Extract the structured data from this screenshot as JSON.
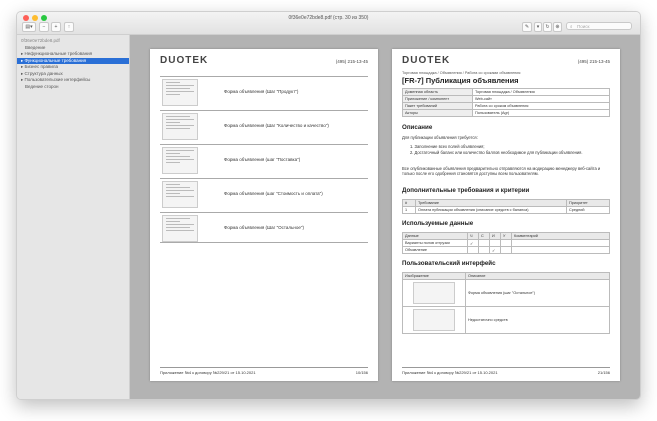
{
  "window": {
    "title": "0f36e0e72bde8.pdf (стр. 30 из 350)",
    "search_placeholder": "Поиск",
    "toolbar": {
      "sidebar": "▤▾",
      "zoom_out": "−",
      "zoom_in": "+",
      "share": "↑",
      "markup": "✎",
      "more": "▾",
      "rotate": "↻",
      "annot": "⊕"
    }
  },
  "sidebar": {
    "items": [
      {
        "label": "0f36e0e72bde8.pdf",
        "type": "head"
      },
      {
        "label": "Введение",
        "type": "ind"
      },
      {
        "label": "▸ Нефункциональные требования",
        "type": "normal"
      },
      {
        "label": "▸ Функциональные требования",
        "type": "sel"
      },
      {
        "label": "▸ Бизнес правила",
        "type": "normal"
      },
      {
        "label": "▸ Структура данных",
        "type": "normal"
      },
      {
        "label": "▸ Пользовательские интерфейсы",
        "type": "normal"
      },
      {
        "label": "Ведение сторон",
        "type": "ind"
      }
    ]
  },
  "left_page": {
    "logo": "DUOTEK",
    "phone": "(495) 215-13-45",
    "rows": [
      {
        "label": "Форма объявления (Шаг \"Продукт\")"
      },
      {
        "label": "Форма объявления (Шаг \"Количество и качество\")"
      },
      {
        "label": "Форма объявления (шаг \"Поставка\")"
      },
      {
        "label": "Форма объявления (шаг \"Стоимость и оплата\")"
      },
      {
        "label": "Форма объявления (Шаг \"Остальное\")"
      }
    ],
    "footer": "Приложение №4 к договору №229/21 от 15.10.2021",
    "page_num": "10/156"
  },
  "right_page": {
    "logo": "DUOTEK",
    "phone": "(495) 215-13-45",
    "breadcrumb": "Торговая площадка / Объявления / Работа со сроками объявления",
    "title": "[FR-7] Публикация объявления",
    "meta": [
      {
        "k": "Доменная область",
        "v": "Торговая площадка / Объявления"
      },
      {
        "k": "Приложение / компонент",
        "v": "Web-сайт"
      },
      {
        "k": "Пакет требований",
        "v": "Работа со сроком объявления"
      },
      {
        "k": "Акторы",
        "v": "Пользователь (Agr)"
      }
    ],
    "desc_h": "Описание",
    "desc_intro": "Для публикации объявления требуется:",
    "desc_items": [
      "1.  Заполнение всех полей объявления;",
      "2.  Достаточный баланс или количество баллов необходимое для публикации объявления."
    ],
    "desc_text": "Все опубликованные объявления предварительно отправляются на модерацию менеджеру веб-сайта и только после его одобрения становятся доступны всем пользователям.",
    "add_h": "Дополнительные требования и критерии",
    "add_head": [
      "#",
      "Требование",
      "Приоритет"
    ],
    "add_rows": [
      [
        "1",
        "Оплата публикации объявления (списание средств с баланса)",
        "Средний"
      ]
    ],
    "data_h": "Используемые данные",
    "data_head": [
      "Данные",
      "Ч",
      "С",
      "И",
      "У",
      "Комментарий"
    ],
    "data_rows": [
      [
        "Варианты полов отгрузки",
        "✓",
        "",
        "",
        "",
        ""
      ],
      [
        "Объявление",
        "",
        "",
        "✓",
        "",
        ""
      ]
    ],
    "ui_h": "Пользовательский интерфейс",
    "ui_head": [
      "Изображение",
      "Описание"
    ],
    "ui_rows": [
      {
        "desc": "Форма объявления (шаг \"Остальное\")"
      },
      {
        "desc": "Недостаточно средств"
      }
    ],
    "footer": "Приложение №4 к договору №229/21 от 15.10.2021",
    "page_num": "21/156"
  }
}
